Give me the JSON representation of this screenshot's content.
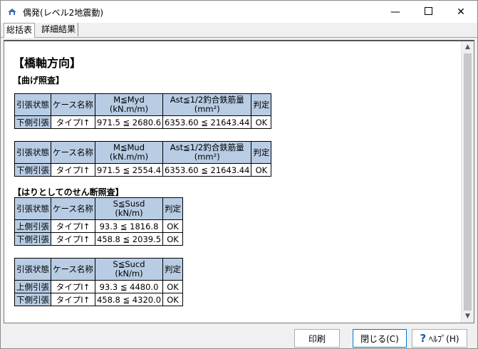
{
  "window": {
    "title": "偶発(レベル2地震動)",
    "min_icon": "minimize-icon",
    "max_icon": "maximize-icon",
    "close_icon": "close-icon"
  },
  "tabs": [
    {
      "label": "総括表"
    },
    {
      "label": "詳細結果"
    }
  ],
  "report": {
    "heading": "【橋軸方向】",
    "bending_heading": "【曲げ照査】",
    "shear_heading": "【はりとしてのせん断照査】",
    "bend_table1": {
      "headers": [
        "引張状態",
        "ケース名称",
        "M≦Myd",
        "(kN.m/m)",
        "Ast≦1/2釣合鉄筋量",
        "(mm²)",
        "判定"
      ],
      "rows": [
        [
          "下側引張",
          "タイプI↑",
          "971.5 ≦ 2680.6",
          "6353.60 ≦ 21643.44",
          "OK"
        ]
      ]
    },
    "bend_table2": {
      "headers": [
        "引張状態",
        "ケース名称",
        "M≦Mud",
        "(kN.m/m)",
        "Ast≦1/2釣合鉄筋量",
        "(mm²)",
        "判定"
      ],
      "rows": [
        [
          "下側引張",
          "タイプI↑",
          "971.5 ≦ 2554.4",
          "6353.60 ≦ 21643.44",
          "OK"
        ]
      ]
    },
    "shear_table1": {
      "headers": [
        "引張状態",
        "ケース名称",
        "S≦Susd",
        "(kN/m)",
        "判定"
      ],
      "rows": [
        [
          "上側引張",
          "タイプI↑",
          "93.3 ≦ 1816.8",
          "OK"
        ],
        [
          "下側引張",
          "タイプI↑",
          "458.8 ≦ 2039.5",
          "OK"
        ]
      ]
    },
    "shear_table2": {
      "headers": [
        "引張状態",
        "ケース名称",
        "S≦Sucd",
        "(kN/m)",
        "判定"
      ],
      "rows": [
        [
          "上側引張",
          "タイプI↑",
          "93.3 ≦ 4480.0",
          "OK"
        ],
        [
          "下側引張",
          "タイプI↑",
          "458.8 ≦ 4320.0",
          "OK"
        ]
      ]
    }
  },
  "buttons": {
    "print": "印刷",
    "close": "閉じる(C)",
    "help": "ﾍﾙﾌﾟ(H)",
    "help_icon": "question-icon"
  },
  "colors": {
    "header_bg": "#b8cce4",
    "help_icon": "#1e5aa8"
  }
}
